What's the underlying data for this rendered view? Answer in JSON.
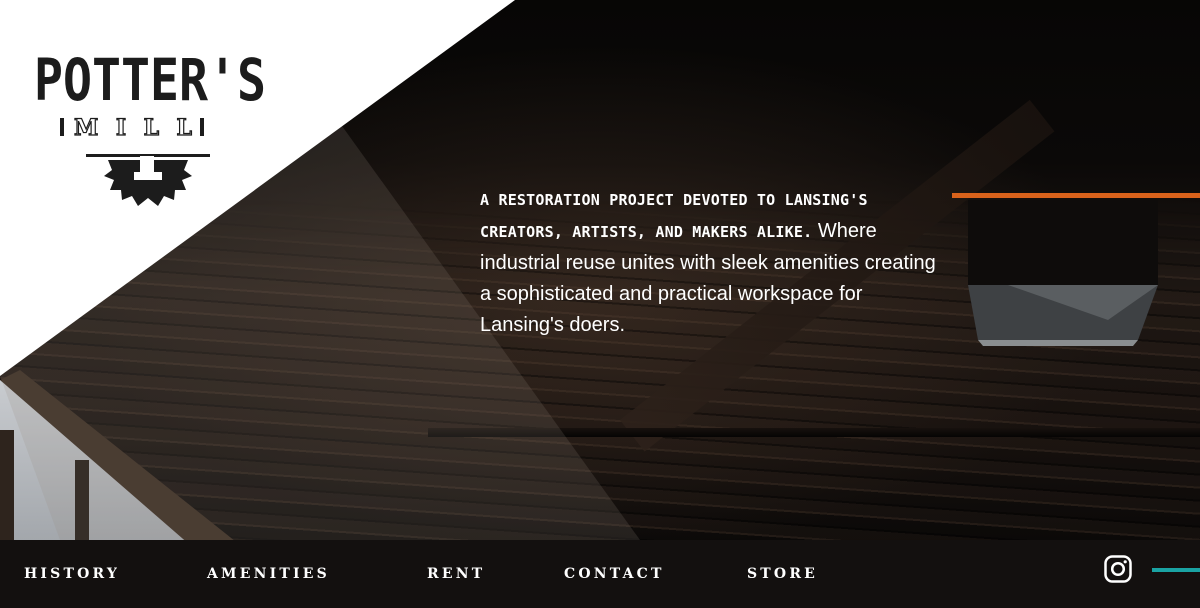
{
  "brand": {
    "logo_top": "POTTER'S",
    "logo_bottom": "MILL"
  },
  "intro": {
    "lead": "A restoration project devoted to Lansing's creators, artists, and makers alike.",
    "body": "Where industrial reuse unites with sleek amenities creating a sophisticated and practical workspace for Lansing's doers."
  },
  "nav": {
    "items": [
      "HISTORY",
      "AMENITIES",
      "RENT",
      "CONTACT",
      "STORE"
    ]
  },
  "social": {
    "instagram_icon": "instagram-icon"
  },
  "colors": {
    "accent_orange": "#d9621b",
    "accent_teal": "#1aa3a3",
    "nav_background": "#13100f",
    "logo_ink": "#1c1c1c"
  }
}
